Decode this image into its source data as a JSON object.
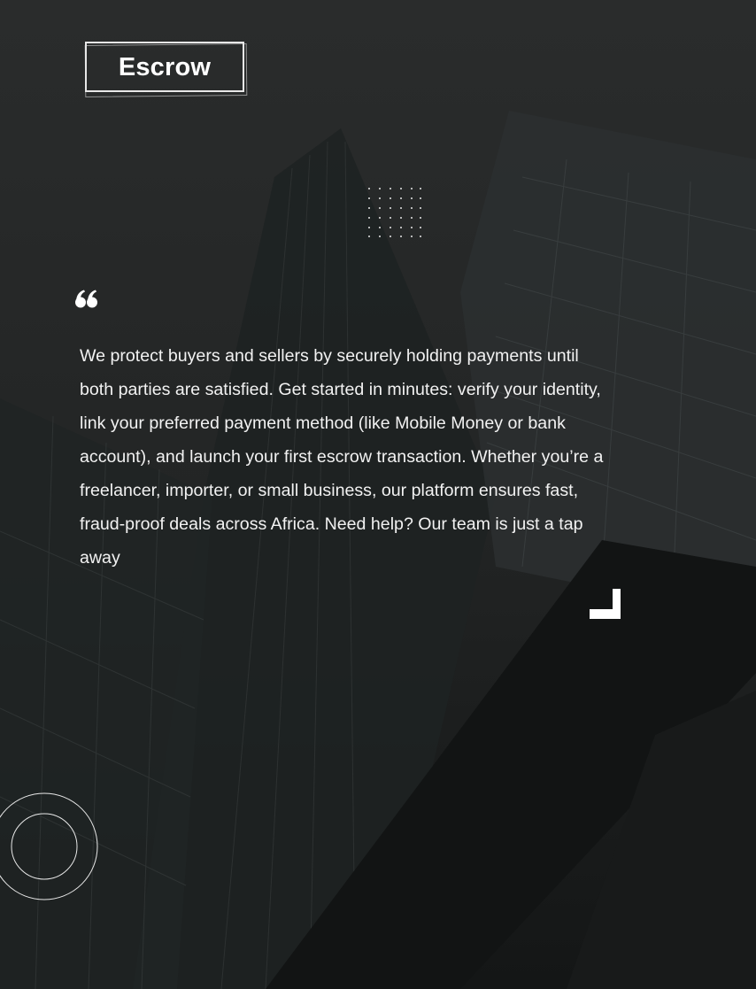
{
  "brand": {
    "logo_text": "Escrow"
  },
  "quote": {
    "icon": "quote-open-icon",
    "text": "We protect buyers and sellers by securely holding payments until both parties are satisfied. Get started in minutes: verify your identity, link your preferred payment method (like Mobile Money or bank account), and launch your first escrow transaction. Whether you’re a freelancer, importer, or small business, our platform ensures fast, fraud-proof deals across Africa. Need help? Our team is just a tap away"
  },
  "decorations": {
    "dot_grid": "dot-grid-icon",
    "corner": "corner-bracket-icon",
    "circles": "concentric-circles-icon"
  },
  "colors": {
    "background": "#1c1e1e",
    "text": "#f2f2f2",
    "accent": "#ffffff"
  }
}
